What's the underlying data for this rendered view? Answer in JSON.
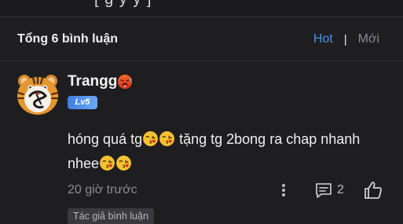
{
  "top_strip": {
    "text": "[ g y y ]"
  },
  "header": {
    "comment_count": "Tổng 6 bình luận",
    "sort_hot": "Hot",
    "sort_separator": "|",
    "sort_new": "Mới",
    "colors": {
      "active": "#4a90e2",
      "inactive": "#8a8a8e"
    }
  },
  "comment": {
    "avatar_icon": "tiger-avatar-icon",
    "username": "Trangg",
    "username_emoji": "hot-face-emoji",
    "level": "Lv5",
    "body_part1": "hóng quá tg",
    "body_emoji_1": "kiss-face-emoji",
    "body_part2": " tặng tg 2bong ra chap nhanh nhee",
    "timestamp": "20 giờ trước",
    "reply_count": "2",
    "author_badge": "Tác giả bình luận",
    "icons": {
      "more": "more-vertical-icon",
      "reply": "reply-icon",
      "like": "thumbs-up-icon"
    }
  }
}
